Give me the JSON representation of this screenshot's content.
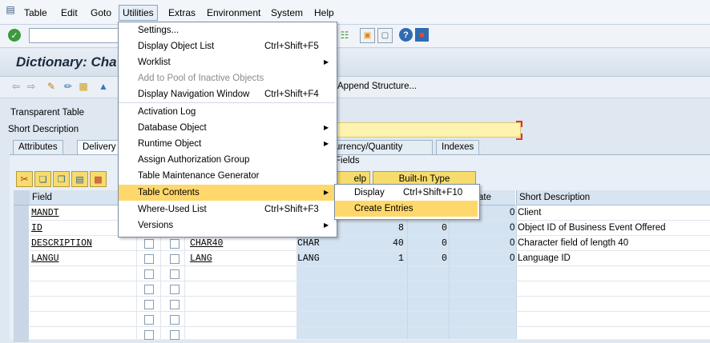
{
  "menubar": {
    "items": [
      "Table",
      "Edit",
      "Goto",
      "Utilities",
      "Extras",
      "Environment",
      "System",
      "Help"
    ]
  },
  "window": {
    "title": "Dictionary: Cha"
  },
  "apptoolbar": {
    "append_structure": "Append Structure..."
  },
  "fields": {
    "transparent_table_label": "Transparent Table",
    "short_description_label": "Short Description"
  },
  "tabs": [
    "Attributes",
    "Delivery a",
    "urrency/Quantity Fields",
    "Indexes"
  ],
  "buttons": {
    "help": "elp",
    "builtin_type": "Built-In Type"
  },
  "grid": {
    "headers": {
      "field": "Field",
      "ate": "ate",
      "short_description": "Short Description"
    },
    "rows": [
      {
        "field": "MANDT",
        "dataelement": "",
        "datatype": "",
        "length": "",
        "decimals": "0",
        "coord": "0",
        "desc": "Client"
      },
      {
        "field": "ID",
        "dataelement": "",
        "datatype": "",
        "length": "8",
        "decimals": "0",
        "coord": "0",
        "desc": "Object ID of Business Event Offered"
      },
      {
        "field": "DESCRIPTION",
        "dataelement": "CHAR40",
        "datatype": "CHAR",
        "length": "40",
        "decimals": "0",
        "coord": "0",
        "desc": "Character field of length 40"
      },
      {
        "field": "LANGU",
        "dataelement": "LANG",
        "datatype": "LANG",
        "length": "1",
        "decimals": "0",
        "coord": "0",
        "desc": "Language ID"
      }
    ]
  },
  "utilities_menu": {
    "items": [
      {
        "label": "Settings...",
        "shortcut": ""
      },
      {
        "label": "Display Object List",
        "shortcut": "Ctrl+Shift+F5"
      },
      {
        "label": "Worklist",
        "shortcut": ""
      },
      {
        "label": "Add to Pool of Inactive Objects",
        "shortcut": ""
      },
      {
        "label": "Display Navigation Window",
        "shortcut": "Ctrl+Shift+F4"
      },
      {
        "label": "Activation Log",
        "shortcut": ""
      },
      {
        "label": "Database Object",
        "shortcut": ""
      },
      {
        "label": "Runtime Object",
        "shortcut": ""
      },
      {
        "label": "Assign Authorization Group",
        "shortcut": ""
      },
      {
        "label": "Table Maintenance Generator",
        "shortcut": ""
      },
      {
        "label": "Table Contents",
        "shortcut": ""
      },
      {
        "label": "Where-Used List",
        "shortcut": "Ctrl+Shift+F3"
      },
      {
        "label": "Versions",
        "shortcut": ""
      }
    ]
  },
  "table_contents_submenu": {
    "items": [
      {
        "label": "Display",
        "shortcut": "Ctrl+Shift+F10"
      },
      {
        "label": "Create Entries",
        "shortcut": ""
      }
    ]
  },
  "icons": {
    "menu_icon": "window-menu-icon",
    "enter": "checkmark-icon",
    "nav": [
      "back-arrow-icon",
      "forward-arrow-icon"
    ]
  },
  "colors": {
    "highlight": "#ffd86b",
    "required_field": "#fff3b0",
    "button": "#f6dc6c"
  }
}
